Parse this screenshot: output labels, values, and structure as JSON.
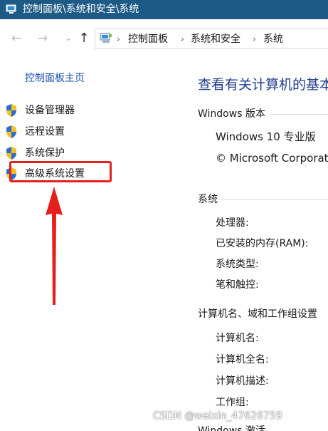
{
  "window": {
    "title": "控制面板\\系统和安全\\系统",
    "titlebar_color": "#1e5a86"
  },
  "navbar": {
    "back_icon": "arrow-left-icon",
    "forward_icon": "arrow-right-icon",
    "recent_icon": "chevron-down-icon",
    "up_icon": "arrow-up-icon",
    "breadcrumbs": [
      "控制面板",
      "系统和安全",
      "系统"
    ]
  },
  "left_pane": {
    "home_link": "控制面板主页",
    "items": [
      {
        "label": "设备管理器",
        "icon": "shield-icon"
      },
      {
        "label": "远程设置",
        "icon": "shield-icon"
      },
      {
        "label": "系统保护",
        "icon": "shield-icon"
      },
      {
        "label": "高级系统设置",
        "icon": "shield-icon"
      }
    ],
    "annotation_color": "#e5201c"
  },
  "main": {
    "heading": "查看有关计算机的基本信息",
    "windows_edition": {
      "title": "Windows 版本",
      "edition": "Windows 10 专业版",
      "copyright": "© Microsoft Corporation"
    },
    "system": {
      "title": "系统",
      "processor": "处理器:",
      "ram": "已安装的内存(RAM):",
      "system_type": "系统类型:",
      "pen_touch": "笔和触控:"
    },
    "computer_name": {
      "title": "计算机名、域和工作组设置",
      "name": "计算机名:",
      "full_name": "计算机全名:",
      "description": "计算机描述:",
      "workgroup": "工作组:"
    },
    "activation_partial": "Windows 激活"
  },
  "watermark": "CSDN @weixin_47626759"
}
